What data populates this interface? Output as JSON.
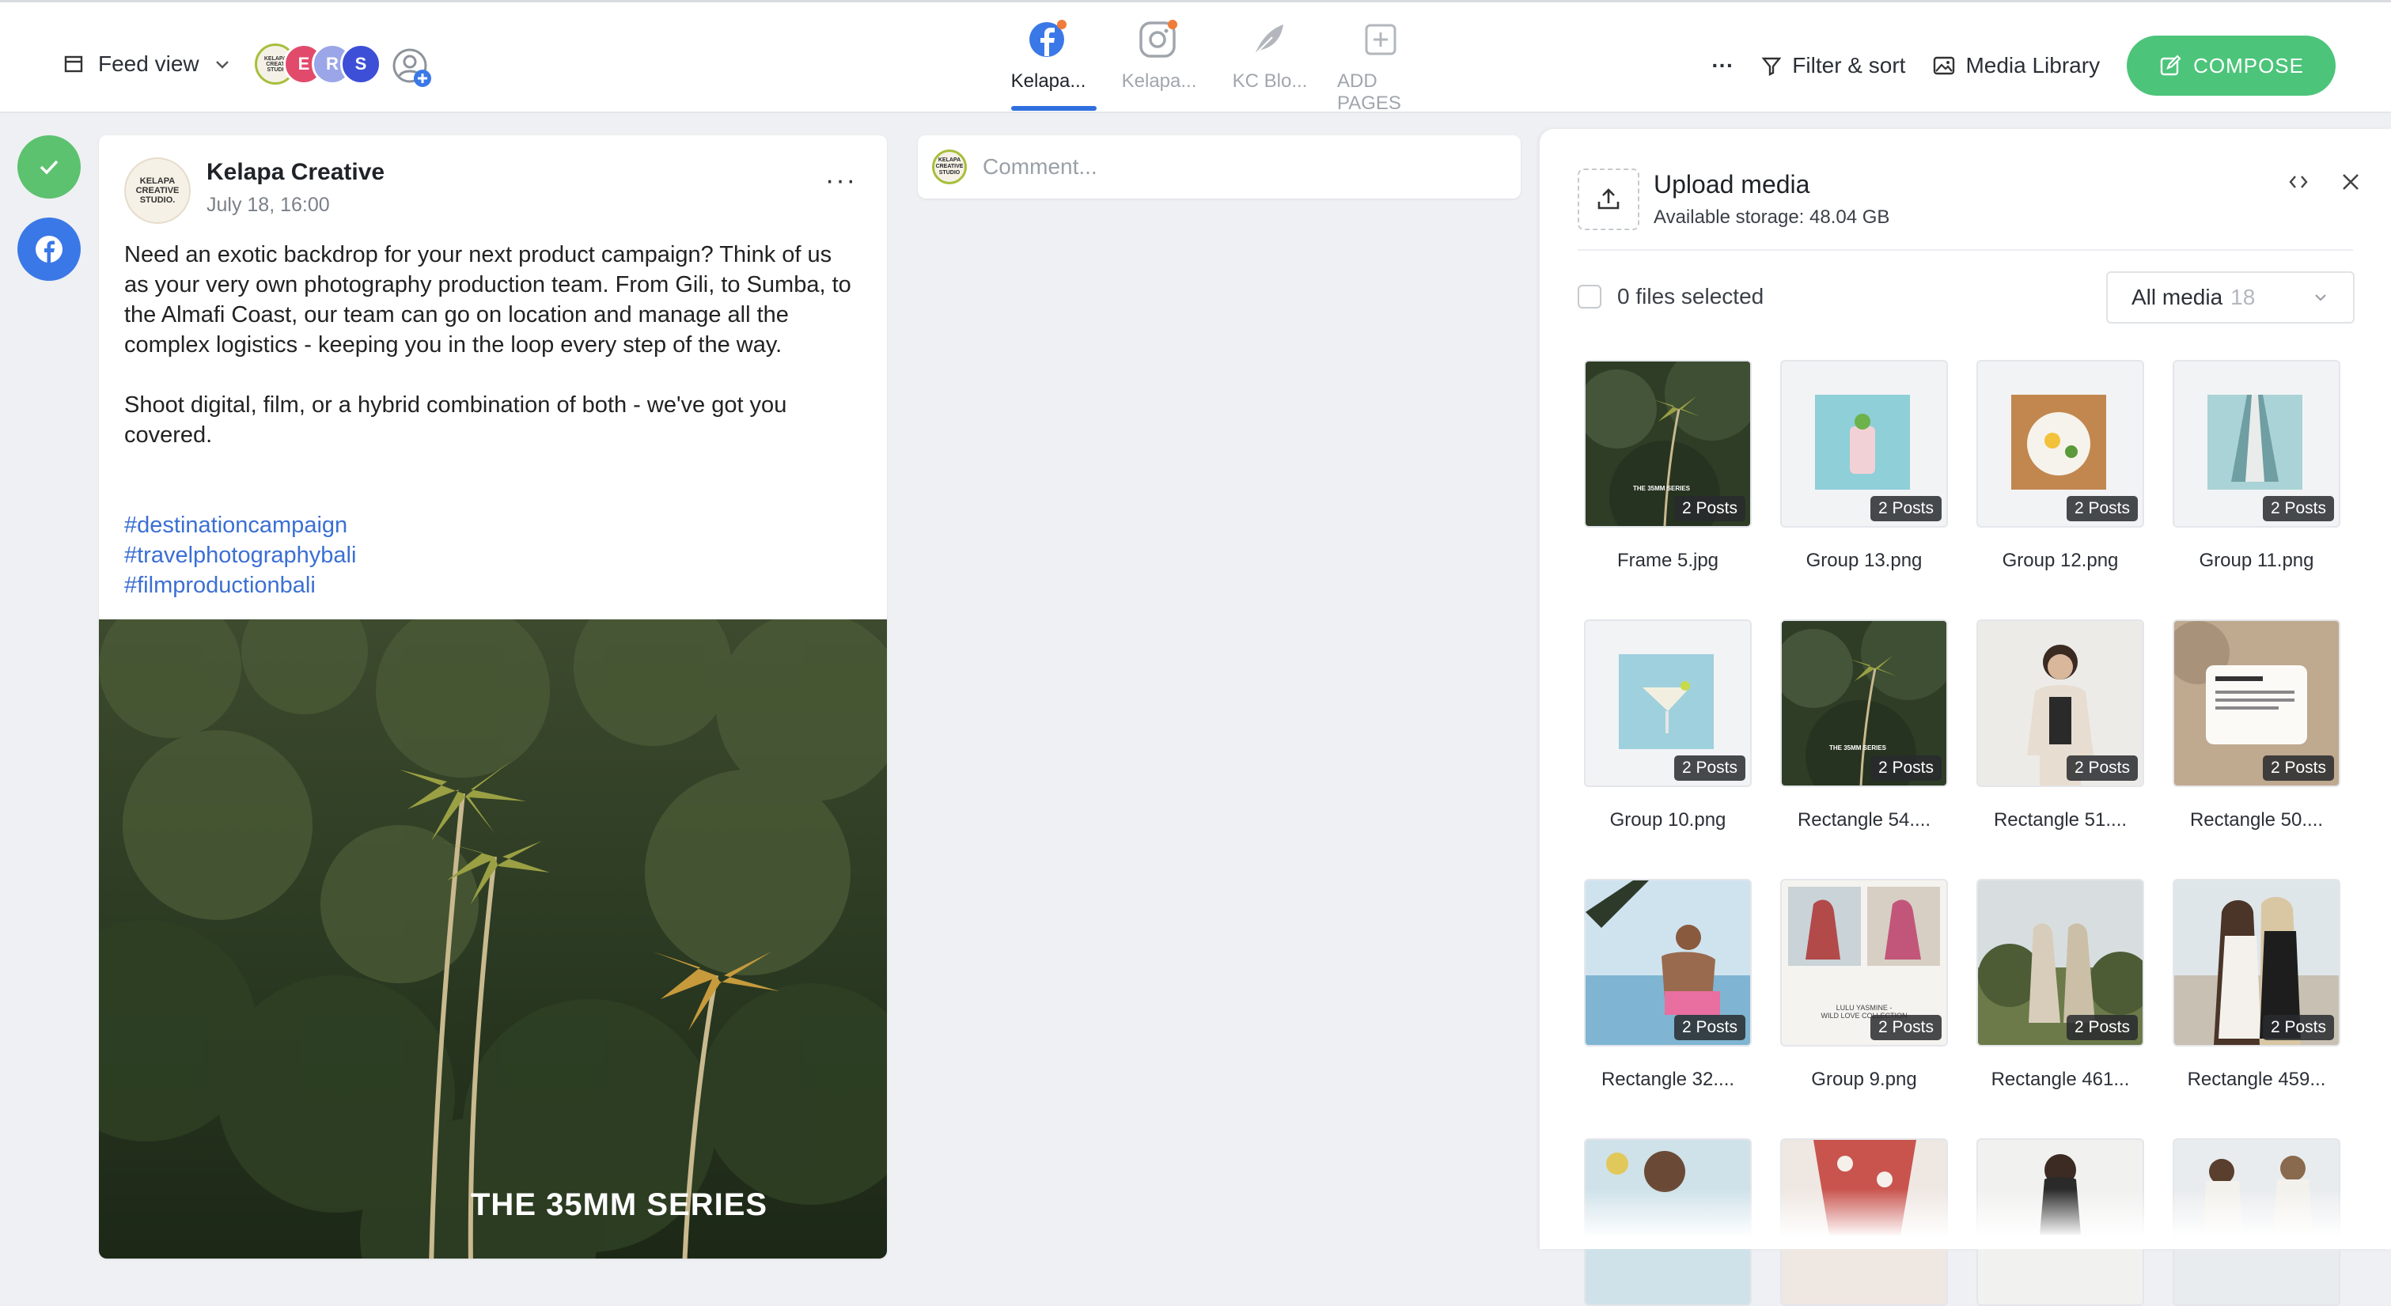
{
  "toolbar": {
    "feed_view_label": "Feed view",
    "avatars": [
      {
        "letter": "",
        "color": "#a7be3a"
      },
      {
        "letter": "E",
        "color": "#e24a6b"
      },
      {
        "letter": "R",
        "color": "#9aa6e8"
      },
      {
        "letter": "S",
        "color": "#3d4fd6"
      }
    ],
    "avatar_logo_text": "KELAPA CREAT STUDI",
    "pages": [
      {
        "label": "Kelapa...",
        "icon": "facebook-icon",
        "active": true
      },
      {
        "label": "Kelapa...",
        "icon": "instagram-icon",
        "active": false
      },
      {
        "label": "KC Blo...",
        "icon": "feather-icon",
        "active": false
      },
      {
        "label": "ADD PAGES",
        "icon": "add-square-icon",
        "active": false
      }
    ],
    "more_label": "···",
    "filter_label": "Filter & sort",
    "media_library_label": "Media Library",
    "compose_label": "COMPOSE"
  },
  "colors": {
    "accent_blue": "#2f6fde",
    "compose_green": "#4cc47a",
    "facebook_blue": "#3b78e7",
    "hashtag_blue": "#3b6fd4"
  },
  "post": {
    "logo_text": "KELAPA CREATIVE STUDIO.",
    "name": "Kelapa Creative",
    "date": "July 18, 16:00",
    "more": "···",
    "paragraph_1": "Need an exotic backdrop for your next product campaign? Think of us as your very own photography production team. From Gili, to Sumba, to the Almafi Coast, our team can go on location and manage all the complex logistics - keeping you in the loop every step of the way.",
    "paragraph_2": "Shoot digital, film, or a hybrid combination of both - we've got you covered.",
    "hashtags": [
      "#destinationcampaign",
      "#travelphotographybali",
      "#filmproductionbali"
    ],
    "image_caption": "THE 35MM SERIES"
  },
  "comment": {
    "logo_text": "KELAPA CREATIVE STUDIO",
    "placeholder": "Comment..."
  },
  "media": {
    "title": "Upload media",
    "storage": "Available storage: 48.04 GB",
    "selected": "0 files selected",
    "filter_label": "All media",
    "filter_count": "18",
    "badge_label": "2 Posts",
    "items": [
      {
        "name": "Frame 5.jpg",
        "kind": "jungle",
        "caption": "THE 35MM SERIES"
      },
      {
        "name": "Group 13.png",
        "kind": "drink"
      },
      {
        "name": "Group 12.png",
        "kind": "food"
      },
      {
        "name": "Group 11.png",
        "kind": "fabric"
      },
      {
        "name": "Group 10.png",
        "kind": "cocktail"
      },
      {
        "name": "Rectangle 54....",
        "kind": "jungle",
        "caption": "THE 35MM SERIES"
      },
      {
        "name": "Rectangle 51....",
        "kind": "model"
      },
      {
        "name": "Rectangle 50....",
        "kind": "card"
      },
      {
        "name": "Rectangle 32....",
        "kind": "pool"
      },
      {
        "name": "Group 9.png",
        "kind": "collage",
        "caption": "LULU YASMINE - WILD LOVE COLLECTION"
      },
      {
        "name": "Rectangle 461...",
        "kind": "field"
      },
      {
        "name": "Rectangle 459...",
        "kind": "beach"
      },
      {
        "name": "",
        "kind": "partial1"
      },
      {
        "name": "",
        "kind": "partial2"
      },
      {
        "name": "",
        "kind": "partial3"
      },
      {
        "name": "",
        "kind": "partial4"
      }
    ]
  }
}
